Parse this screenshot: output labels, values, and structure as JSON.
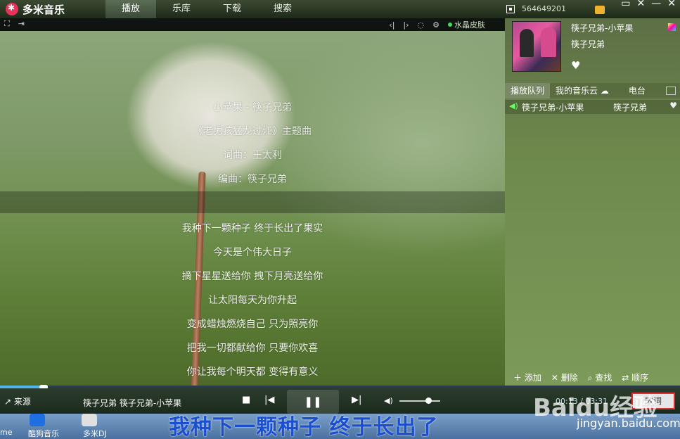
{
  "app": {
    "title": "多米音乐"
  },
  "tabs": [
    {
      "label": "播放",
      "active": true
    },
    {
      "label": "乐库",
      "active": false
    },
    {
      "label": "下载",
      "active": false
    },
    {
      "label": "搜索",
      "active": false
    }
  ],
  "user": {
    "id": "564649201"
  },
  "window_buttons": [
    "▭",
    "✕",
    "—",
    "✕"
  ],
  "visual_toolbar": {
    "skin_label": "水晶皮肤"
  },
  "lyrics": {
    "header": [
      "小苹果 - 筷子兄弟",
      "《老男孩猛龙过江》主题曲",
      "词曲：王太利",
      "编曲：筷子兄弟"
    ],
    "lines": [
      "我种下一颗种子  终于长出了果实",
      "今天是个伟大日子",
      "摘下星星送给你  拽下月亮送给你",
      "让太阳每天为你升起",
      "变成蜡烛燃烧自己  只为照亮你",
      "把我一切都献给你  只要你欢喜",
      "你让我每个明天都  变得有意义"
    ]
  },
  "now_playing": {
    "title": "筷子兄弟-小苹果",
    "artist": "筷子兄弟"
  },
  "panel_tabs": [
    {
      "label": "播放队列",
      "active": true
    },
    {
      "label": "我的音乐云",
      "active": false
    },
    {
      "label": "电台",
      "active": false
    }
  ],
  "queue": [
    {
      "title": "筷子兄弟-小苹果",
      "artist": "筷子兄弟"
    }
  ],
  "panel_actions": {
    "add": "添加",
    "delete": "删除",
    "find": "查找",
    "order": "顺序"
  },
  "player": {
    "source_label": "来源",
    "track": "筷子兄弟 筷子兄弟-小苹果",
    "time": "00:13 / 03:31",
    "lyric_button": "歌词",
    "progress": 0.07,
    "volume": 0.7
  },
  "taskbar": [
    {
      "label": "me"
    },
    {
      "label": "酷狗音乐"
    },
    {
      "label": "多米DJ"
    }
  ],
  "desktop_lyric": "我种下一颗种子  终于长出了",
  "watermark": {
    "brand": "Baidu经验",
    "url": "jingyan.baidu.com"
  }
}
